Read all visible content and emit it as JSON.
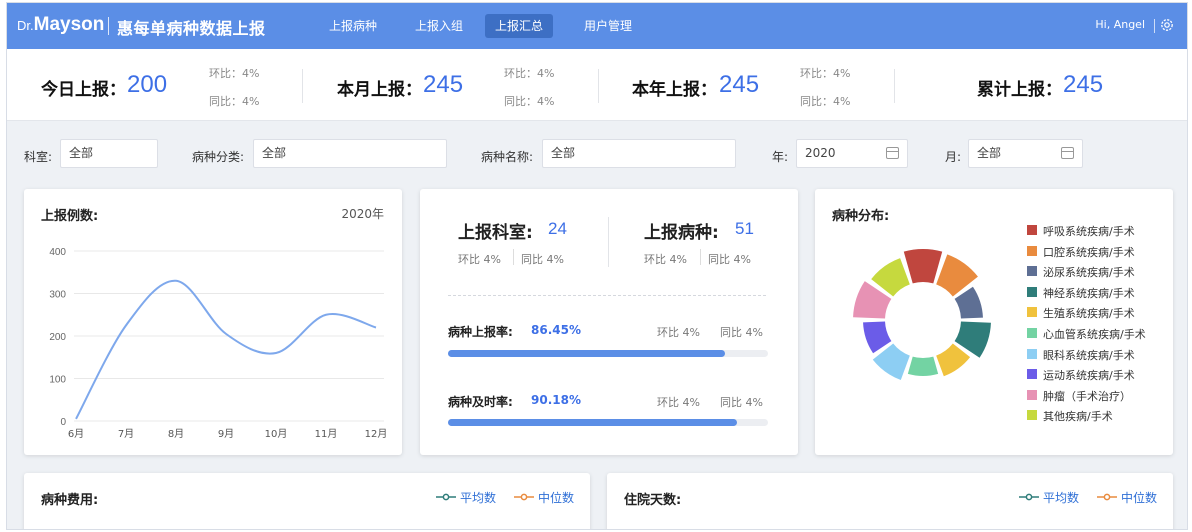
{
  "nav": {
    "logo_dr": "Dr.",
    "logo_name": "Mayson",
    "app_title": "惠每单病种数据上报",
    "items": [
      "上报病种",
      "上报入组",
      "上报汇总",
      "用户管理"
    ],
    "active_index": 2,
    "user": "Hi, Angel"
  },
  "stats": [
    {
      "label": "今日上报：",
      "value": "200",
      "hb": "环比：4%",
      "tb": "同比：4%"
    },
    {
      "label": "本月上报：",
      "value": "245",
      "hb": "环比：4%",
      "tb": "同比：4%"
    },
    {
      "label": "本年上报：",
      "value": "245",
      "hb": "环比：4%",
      "tb": "同比：4%"
    },
    {
      "label": "累计上报：",
      "value": "245"
    }
  ],
  "filters": {
    "dept_label": "科室:",
    "dept_value": "全部",
    "cat_label": "病种分类:",
    "cat_value": "全部",
    "name_label": "病种名称:",
    "name_value": "全部",
    "year_label": "年:",
    "year_value": "2020",
    "month_label": "月:",
    "month_value": "全部"
  },
  "line_card": {
    "title": "上报例数:",
    "year": "2020年"
  },
  "chart_data": {
    "type": "line",
    "categories": [
      "6月",
      "7月",
      "8月",
      "9月",
      "10月",
      "11月",
      "12月"
    ],
    "values": [
      5,
      225,
      330,
      205,
      160,
      250,
      220
    ],
    "ylim": [
      0,
      400
    ],
    "yticks": [
      0,
      100,
      200,
      300,
      400
    ],
    "grid": true,
    "color": "#7ea8ec"
  },
  "mid_card": {
    "dept_label": "上报科室:",
    "dept_value": "24",
    "dept_hb": "环比 4%",
    "dept_tb": "同比 4%",
    "disease_label": "上报病种:",
    "disease_value": "51",
    "disease_hb": "环比 4%",
    "disease_tb": "同比 4%",
    "rate1_label": "病种上报率:",
    "rate1_value": "86.45%",
    "rate1_fraction": 0.8645,
    "rate1_hb": "环比 4%",
    "rate1_tb": "同比 4%",
    "rate2_label": "病种及时率:",
    "rate2_value": "90.18%",
    "rate2_fraction": 0.9018,
    "rate2_hb": "环比 4%",
    "rate2_tb": "同比 4%"
  },
  "donut": {
    "title": "病种分布:",
    "items": [
      {
        "name": "呼吸系统疾病/手术",
        "color": "#c0463e"
      },
      {
        "name": "口腔系统疾病/手术",
        "color": "#e98b3e"
      },
      {
        "name": "泌尿系统疾病/手术",
        "color": "#5e6f94"
      },
      {
        "name": "神经系统疾病/手术",
        "color": "#2f7d7a"
      },
      {
        "name": "生殖系统疾病/手术",
        "color": "#f0c23d"
      },
      {
        "name": "心血管系统疾病/手术",
        "color": "#73d3a3"
      },
      {
        "name": "眼科系统疾病/手术",
        "color": "#8dcef3"
      },
      {
        "name": "运动系统疾病/手术",
        "color": "#6b5ce8"
      },
      {
        "name": "肿瘤（手术治疗）",
        "color": "#e792b4"
      },
      {
        "name": "其他疾病/手术",
        "color": "#c6d93e"
      }
    ]
  },
  "bottom": {
    "cost_title": "病种费用:",
    "days_title": "住院天数:",
    "avg": "平均数",
    "median": "中位数",
    "avg_color": "#2f7d7a",
    "median_color": "#e98b3e"
  }
}
